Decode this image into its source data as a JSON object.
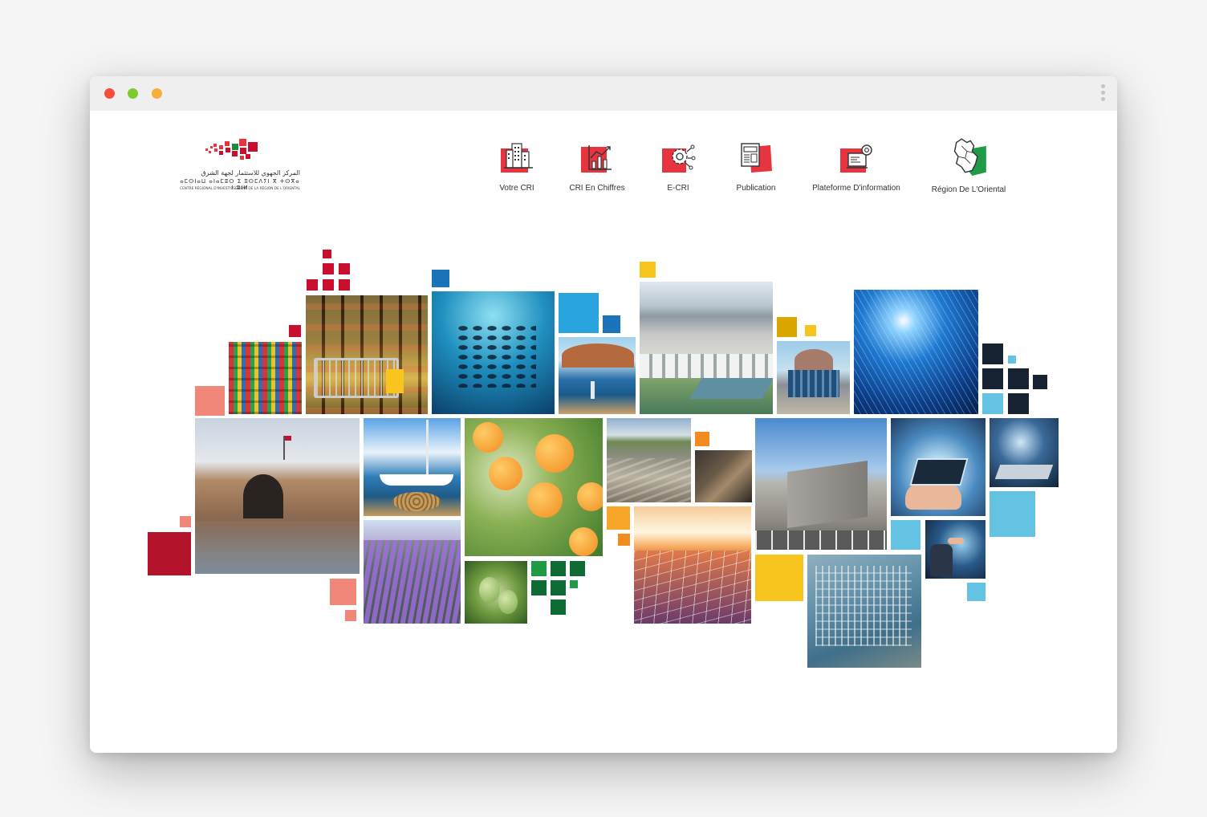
{
  "window": {
    "controls": [
      "close",
      "minimize",
      "maximize"
    ],
    "control_colors": [
      "#f44e3f",
      "#7bcc2f",
      "#f9ad3a"
    ]
  },
  "logo": {
    "arabic": "المركز الجهوي للاستثمار لجهة الشرق",
    "tifinagh": "ⴰⵎⵙⵏⴰⵡ ⴰⵏⴰⵎⵓⵔ ⵉ ⵓⵙⵎⴷⵢⵏ ⴳ ⵜⵙⴳⴰ ⵏ ⵓⵏⵍ",
    "french": "CENTRE RÉGIONAL D'INVESTISSEMENT DE LA RÉGION DE L'ORIENTAL",
    "colors": [
      "#c8102e",
      "#e63946",
      "#1a8d3d"
    ]
  },
  "nav": [
    {
      "label": "Votre CRI",
      "icon": "building-icon"
    },
    {
      "label": "CRI En Chiffres",
      "icon": "chart-icon"
    },
    {
      "label": "E-CRI",
      "icon": "gear-network-icon"
    },
    {
      "label": "Publication",
      "icon": "newspaper-icon"
    },
    {
      "label": "Plateforme D'information",
      "icon": "info-platform-icon"
    },
    {
      "label": "Région De L'Oriental",
      "icon": "region-map-icon"
    }
  ],
  "theme": {
    "red": "#e8343e",
    "dark_red": "#b5132b",
    "blue": "#1b73b9",
    "sky": "#29a3dd",
    "light_blue": "#64c3e3",
    "yellow": "#f7c51e",
    "orange": "#f28b20",
    "salmon": "#f08779",
    "green": "#1f9a47",
    "dark_green": "#0f6b34",
    "navy": "#172232"
  },
  "mosaic_photos": [
    {
      "subject": "market-stall-photo"
    },
    {
      "subject": "supermarket-cart-photo"
    },
    {
      "subject": "fish-school-photo"
    },
    {
      "subject": "coastal-fisherman-photo"
    },
    {
      "subject": "city-development-photo"
    },
    {
      "subject": "domed-building-photo"
    },
    {
      "subject": "digital-globe-photo"
    },
    {
      "subject": "kasbah-gate-photo"
    },
    {
      "subject": "sailboat-marina-photo"
    },
    {
      "subject": "orange-tree-photo"
    },
    {
      "subject": "quarry-photo"
    },
    {
      "subject": "machinery-photo"
    },
    {
      "subject": "modern-building-photo"
    },
    {
      "subject": "tech-hand-tablet-photo"
    },
    {
      "subject": "tech-hand-icons-photo"
    },
    {
      "subject": "lavender-field-photo"
    },
    {
      "subject": "green-almond-photo"
    },
    {
      "subject": "solar-panels-photo"
    },
    {
      "subject": "port-aerial-photo"
    },
    {
      "subject": "businessman-touch-photo"
    }
  ]
}
